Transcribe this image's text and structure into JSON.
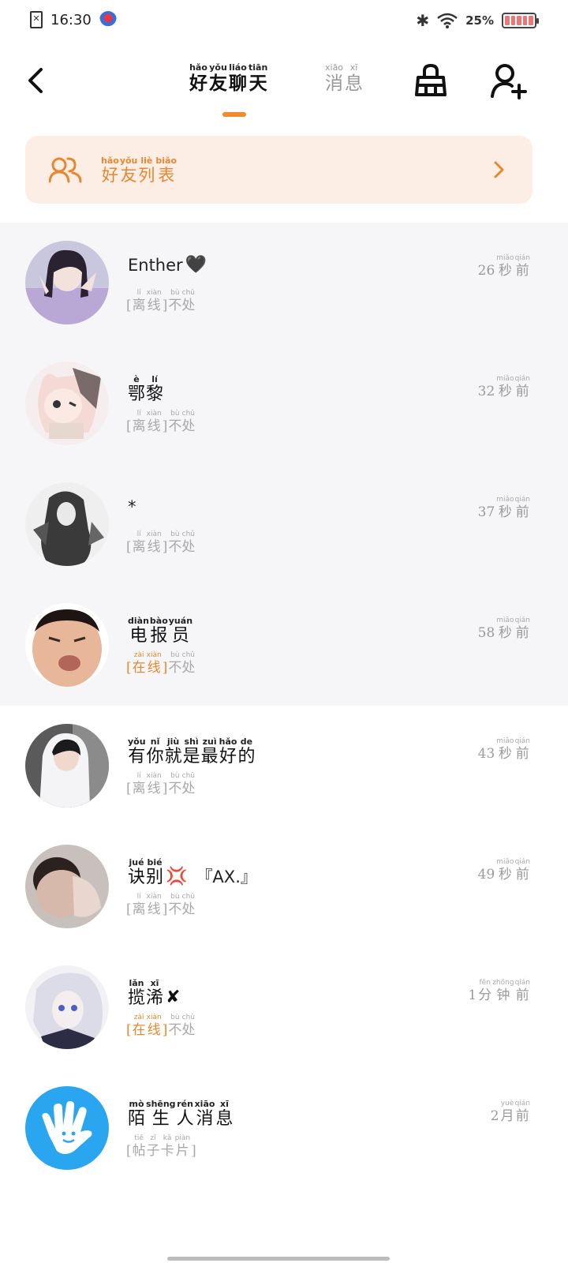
{
  "status_bar": {
    "time": "16:30",
    "battery_percent": "25%",
    "battery_level": 0.25,
    "icons": [
      "sim-error-icon",
      "app-notification-icon",
      "bluetooth-icon",
      "wifi-icon",
      "battery-icon"
    ]
  },
  "header": {
    "tabs": [
      {
        "chars": [
          {
            "py": "hǎo",
            "hz": "好"
          },
          {
            "py": "yǒu",
            "hz": "友"
          },
          {
            "py": "liáo",
            "hz": "聊"
          },
          {
            "py": "tiān",
            "hz": "天"
          }
        ],
        "active": true
      },
      {
        "chars": [
          {
            "py": "xiāo",
            "hz": "消"
          },
          {
            "py": "xī",
            "hz": "息"
          }
        ],
        "active": false
      }
    ],
    "accent_color": "#f08a2c"
  },
  "friend_list_banner": {
    "chars": [
      {
        "py": "hǎo",
        "hz": "好"
      },
      {
        "py": "yǒu",
        "hz": "友"
      },
      {
        "py": "liè",
        "hz": "列"
      },
      {
        "py": "biǎo",
        "hz": "表"
      }
    ],
    "background": "#fdeee5",
    "color": "#e6882f"
  },
  "status_labels": {
    "offline": [
      {
        "py": "lí",
        "hz": "离"
      },
      {
        "py": "xiàn",
        "hz": "线"
      }
    ],
    "online": [
      {
        "py": "zài",
        "hz": "在"
      },
      {
        "py": "xiàn",
        "hz": "线"
      }
    ],
    "dnd": [
      {
        "py": "bù",
        "hz": "不"
      },
      {
        "py": "chǔ",
        "hz": "处"
      }
    ],
    "post_card": [
      {
        "py": "tiě",
        "hz": "帖"
      },
      {
        "py": "zǐ",
        "hz": "子"
      },
      {
        "py": "kǎ",
        "hz": "卡"
      },
      {
        "py": "piàn",
        "hz": "片"
      }
    ]
  },
  "time_units": {
    "seconds_ago": [
      {
        "py": "miǎo",
        "hz": "秒"
      },
      {
        "py": "qián",
        "hz": "前"
      }
    ],
    "minutes_ago": [
      {
        "py": "fēn",
        "hz": "分"
      },
      {
        "py": "zhōng",
        "hz": "钟"
      },
      {
        "py": "qián",
        "hz": "前"
      }
    ],
    "months_ago": [
      {
        "py": "yuè",
        "hz": "月"
      },
      {
        "py": "qián",
        "hz": "前"
      }
    ]
  },
  "chats": [
    {
      "name_plain": "Enther",
      "name_chars": [],
      "emoji": "🖤",
      "suffix": "",
      "status": "offline",
      "time_num": "26",
      "time_unit": "seconds_ago",
      "tinted": true
    },
    {
      "name_plain": "",
      "name_chars": [
        {
          "py": "è",
          "hz": "鄂"
        },
        {
          "py": "lí",
          "hz": "黎"
        }
      ],
      "emoji": "",
      "suffix": "",
      "status": "offline",
      "time_num": "32",
      "time_unit": "seconds_ago",
      "tinted": true
    },
    {
      "name_plain": "*",
      "name_chars": [],
      "emoji": "",
      "suffix": "",
      "status": "offline",
      "time_num": "37",
      "time_unit": "seconds_ago",
      "tinted": true
    },
    {
      "name_plain": "",
      "name_chars": [
        {
          "py": "diàn",
          "hz": "电"
        },
        {
          "py": "bào",
          "hz": "报"
        },
        {
          "py": "yuán",
          "hz": "员"
        }
      ],
      "emoji": "",
      "suffix": "",
      "status": "online",
      "time_num": "58",
      "time_unit": "seconds_ago",
      "tinted": true
    },
    {
      "name_plain": "",
      "name_chars": [
        {
          "py": "yǒu",
          "hz": "有"
        },
        {
          "py": "nǐ",
          "hz": "你"
        },
        {
          "py": "jiù",
          "hz": "就"
        },
        {
          "py": "shì",
          "hz": "是"
        },
        {
          "py": "zuì",
          "hz": "最"
        },
        {
          "py": "hǎo",
          "hz": "好"
        },
        {
          "py": "de",
          "hz": "的"
        }
      ],
      "emoji": "",
      "suffix": "",
      "status": "offline",
      "time_num": "43",
      "time_unit": "seconds_ago",
      "tinted": false
    },
    {
      "name_plain": "",
      "name_chars": [
        {
          "py": "jué",
          "hz": "诀"
        },
        {
          "py": "bié",
          "hz": "别"
        }
      ],
      "emoji": "💢",
      "suffix": "『AX.』",
      "status": "offline",
      "time_num": "49",
      "time_unit": "seconds_ago",
      "tinted": false
    },
    {
      "name_plain": "",
      "name_chars": [
        {
          "py": "lǎn",
          "hz": "揽"
        },
        {
          "py": "xī",
          "hz": "浠"
        }
      ],
      "emoji": "✘",
      "suffix": "",
      "status": "online",
      "time_num": "1",
      "time_unit": "minutes_ago",
      "tinted": false
    },
    {
      "name_plain": "",
      "name_chars": [
        {
          "py": "mò",
          "hz": "陌"
        },
        {
          "py": "shēng",
          "hz": "生"
        },
        {
          "py": "rén",
          "hz": "人"
        },
        {
          "py": "xiāo",
          "hz": "消"
        },
        {
          "py": "xī",
          "hz": "息"
        }
      ],
      "emoji": "",
      "suffix": "",
      "status": "post_card",
      "time_num": "2",
      "time_unit": "months_ago",
      "tinted": false
    }
  ]
}
